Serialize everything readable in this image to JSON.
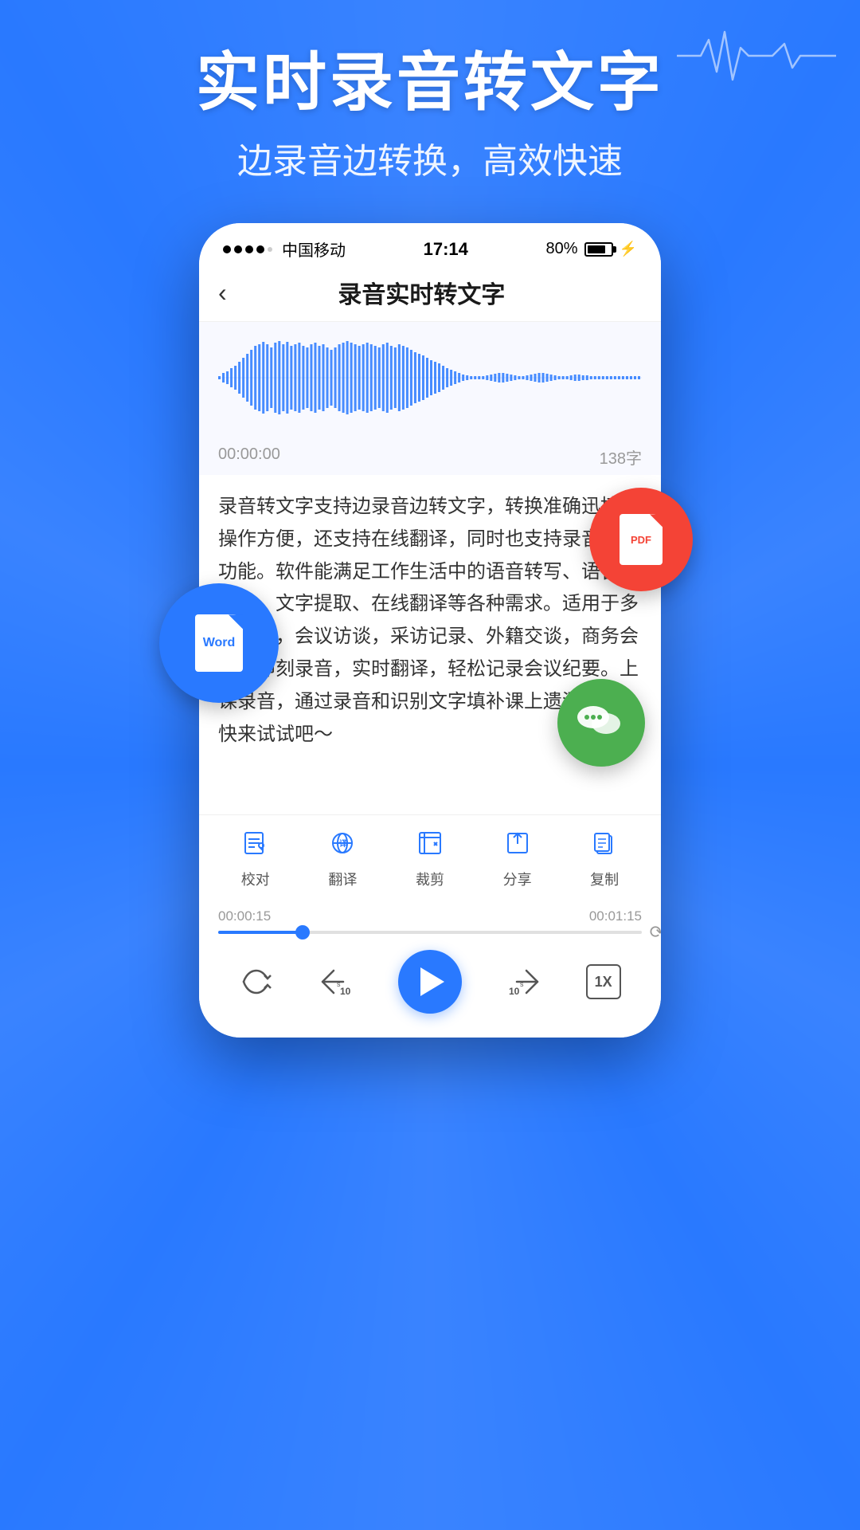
{
  "background_color": "#2979ff",
  "header": {
    "title": "实时录音转文字",
    "subtitle": "边录音边转换，高效快速"
  },
  "phone": {
    "status_bar": {
      "signal": "●●●●○",
      "carrier": "中国移动",
      "time": "17:14",
      "battery": "80%"
    },
    "nav": {
      "back_label": "‹",
      "title": "录音实时转文字"
    },
    "timer": {
      "start": "00:00:00",
      "char_count": "138字"
    },
    "transcript": "录音转文字支持边录音边转文字，转换准确迅捷，操作方便，还支持在线翻译，同时也支持录音机的功能。软件能满足工作生活中的语音转写、语音备忘录、文字提取、在线翻译等各种需求。适用于多种场景，会议访谈，采访记录、外籍交谈，商务会议，即刻录音，实时翻译，轻松记录会议纪要。上课录音，通过录音和识别文字填补课上遗漏知识。快来试试吧～",
    "toolbar": {
      "items": [
        {
          "icon": "✎",
          "label": "校对"
        },
        {
          "icon": "译",
          "label": "翻译"
        },
        {
          "icon": "✂",
          "label": "裁剪"
        },
        {
          "icon": "⬆",
          "label": "分享"
        },
        {
          "icon": "⬜",
          "label": "复制"
        }
      ]
    },
    "progress": {
      "current": "00:00:15",
      "total": "00:01:15",
      "percent": 20
    },
    "playback": {
      "speed_label": "1X"
    }
  },
  "floating": {
    "word_label": "Word",
    "pdf_label": "PDF"
  }
}
